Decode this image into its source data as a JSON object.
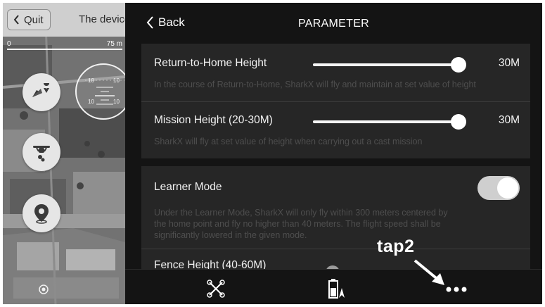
{
  "map": {
    "quit_label": "Quit",
    "device_title": "The device",
    "scale": {
      "left": "0",
      "right": "75 m"
    },
    "attitude_ticks": [
      "10",
      "10",
      "10",
      "10"
    ],
    "icons": [
      "send-location-icon",
      "drone-icon",
      "map-pin-icon",
      "locate-icon"
    ]
  },
  "header": {
    "back_label": "Back",
    "title": "PARAMETER"
  },
  "settings": {
    "rth": {
      "title": "Return-to-Home Height",
      "description": "In the course of Return-to-Home, SharkX will fly and maintain at set value of height",
      "value": "30M",
      "slider_fraction": 0.95
    },
    "mission": {
      "title": "Mission Height (20-30M)",
      "description": "SharkX will fly at set value of height when carrying out a cast mission",
      "value": "30M",
      "slider_fraction": 0.95
    },
    "learner": {
      "title": "Learner Mode",
      "description_lines": [
        "Under the Learner Mode, SharkX will only fly within 300 meters centered by",
        "the home point and fly no higher than 40 meters. The flight speed shall be",
        "significantly lowered in the given mode."
      ],
      "enabled": true
    },
    "fence": {
      "title": "Fence Height (40-60M)"
    }
  },
  "bottom_bar": {
    "icons": [
      "drone-arms-icon",
      "battery-icon",
      "more-icon"
    ]
  },
  "annotation": {
    "label": "tap2"
  },
  "colors": {
    "panel_bg": "#141414",
    "card_bg": "#262626",
    "toggle_on": "#cfcfcf"
  }
}
